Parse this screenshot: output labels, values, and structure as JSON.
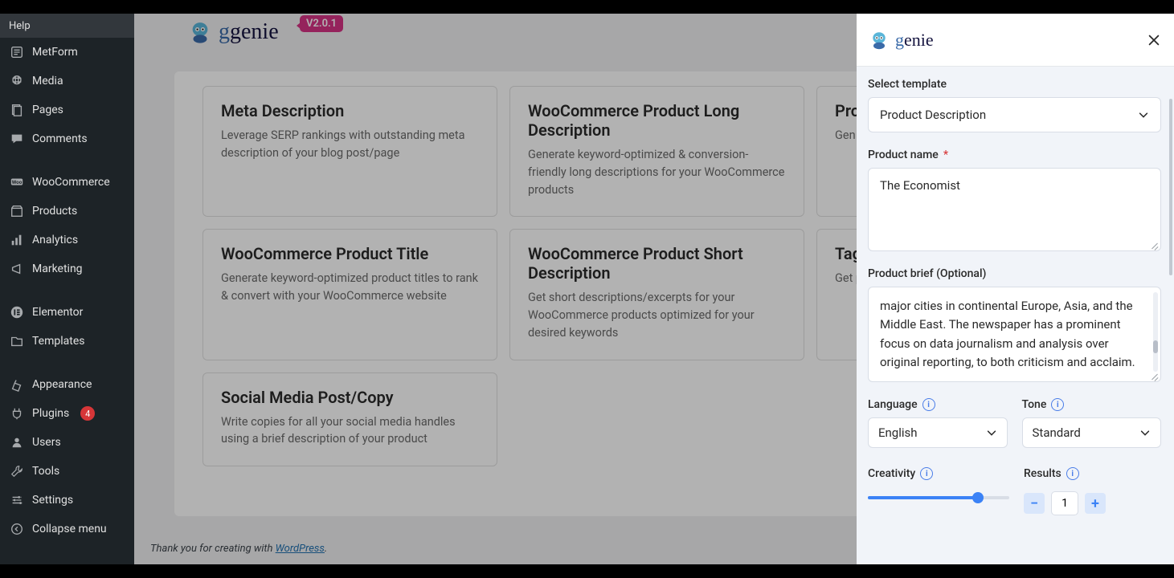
{
  "help_label": "Help",
  "sidebar": [
    {
      "icon": "metform",
      "label": "MetForm"
    },
    {
      "icon": "media",
      "label": "Media"
    },
    {
      "icon": "pages",
      "label": "Pages"
    },
    {
      "icon": "comments",
      "label": "Comments"
    },
    {
      "sep": true
    },
    {
      "icon": "woocommerce",
      "label": "WooCommerce"
    },
    {
      "icon": "products",
      "label": "Products"
    },
    {
      "icon": "analytics",
      "label": "Analytics"
    },
    {
      "icon": "marketing",
      "label": "Marketing"
    },
    {
      "sep": true
    },
    {
      "icon": "elementor",
      "label": "Elementor"
    },
    {
      "icon": "templates",
      "label": "Templates"
    },
    {
      "sep": true
    },
    {
      "icon": "appearance",
      "label": "Appearance"
    },
    {
      "icon": "plugins",
      "label": "Plugins",
      "badge": "4"
    },
    {
      "icon": "users",
      "label": "Users"
    },
    {
      "icon": "tools",
      "label": "Tools"
    },
    {
      "icon": "settings",
      "label": "Settings"
    },
    {
      "icon": "collapse",
      "label": "Collapse menu"
    }
  ],
  "logo_text": "genie",
  "version": "V2.0.1",
  "cards": [
    {
      "title": "Meta Description",
      "desc": "Leverage SERP rankings with outstanding meta description of your blog post/page"
    },
    {
      "title": "WooCommerce Product Long Description",
      "desc": "Generate keyword-optimized & conversion-friendly long descriptions for your WooCommerce products"
    },
    {
      "title": "Pro",
      "desc": "Gen topi"
    },
    {
      "title": "WooCommerce Product Title",
      "desc": "Generate keyword-optimized product titles to rank & convert with your WooCommerce website"
    },
    {
      "title": "WooCommerce Product Short Description",
      "desc": "Get short descriptions/excerpts for your WooCommerce products optimized for your desired keywords"
    },
    {
      "title": "Tag",
      "desc": "Get proc"
    },
    {
      "title": "Social Media Post/Copy",
      "desc": "Write copies for all your social media handles using a brief description of your product"
    }
  ],
  "footer": {
    "prefix": "Thank you for creating with ",
    "link": "WordPress"
  },
  "drawer": {
    "select_template_label": "Select template",
    "template_value": "Product Description",
    "product_name_label": "Product name",
    "product_name_value": "The Economist",
    "product_brief_label": "Product brief (Optional)",
    "product_brief_value": "major cities in continental Europe, Asia, and the Middle East. The newspaper has a prominent focus on data journalism and analysis over original reporting, to both criticism and acclaim.",
    "language_label": "Language",
    "language_value": "English",
    "tone_label": "Tone",
    "tone_value": "Standard",
    "creativity_label": "Creativity",
    "results_label": "Results",
    "results_value": "1"
  }
}
